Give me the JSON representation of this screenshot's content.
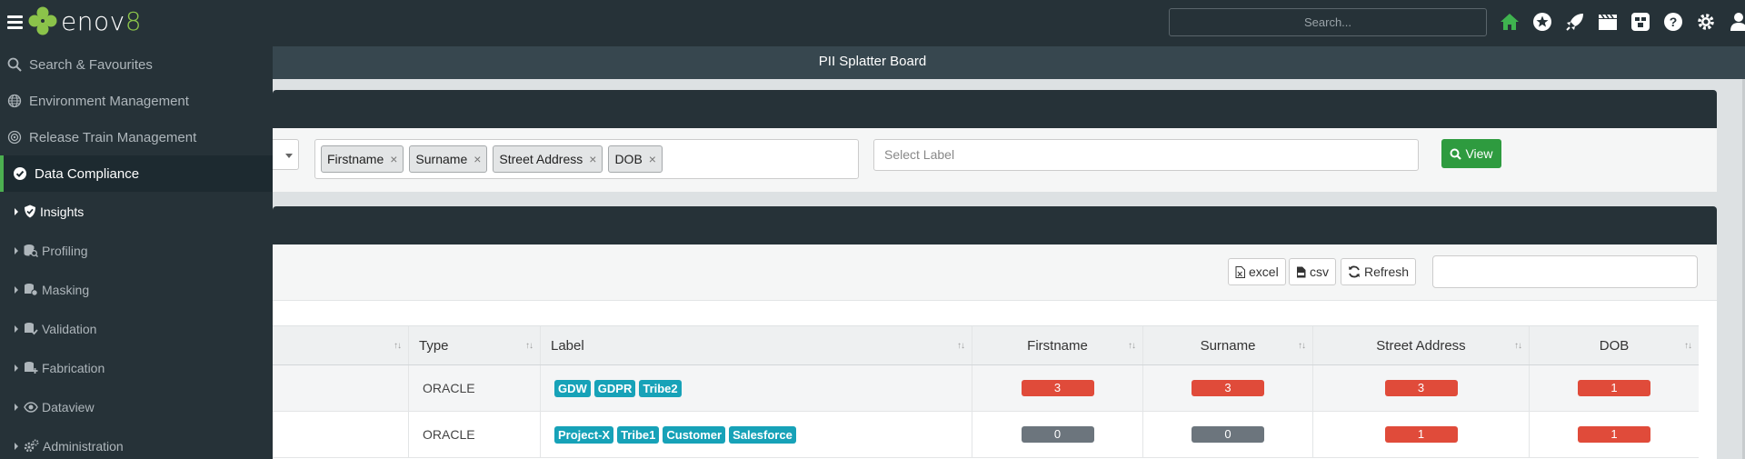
{
  "app": {
    "logo_text": "enov8",
    "search_placeholder": "Search...",
    "page_title": "PII Splatter Board"
  },
  "top_icons": [
    "home-icon",
    "star-icon",
    "rocket-icon",
    "clapper-icon",
    "slack-icon",
    "help-icon",
    "gear-icon",
    "user-icon"
  ],
  "colors": {
    "brand_green": "#8bc34a",
    "accent_green": "#2e9b3f",
    "dark": "#263238",
    "red": "#e04b3a",
    "teal": "#17a2b8",
    "grey": "#6c757d"
  },
  "sidebar": {
    "items": [
      {
        "label": "Search & Favourites",
        "icon": "search-icon"
      },
      {
        "label": "Environment Management",
        "icon": "globe-icon"
      },
      {
        "label": "Release Train Management",
        "icon": "target-icon"
      },
      {
        "label": "Data Compliance",
        "icon": "check-circle-icon"
      }
    ],
    "sub_items": [
      {
        "label": "Insights",
        "icon": "shield-check-icon"
      },
      {
        "label": "Profiling",
        "icon": "database-search-icon"
      },
      {
        "label": "Masking",
        "icon": "database-mask-icon"
      },
      {
        "label": "Validation",
        "icon": "database-check-icon"
      },
      {
        "label": "Fabrication",
        "icon": "database-plus-icon"
      },
      {
        "label": "Dataview",
        "icon": "eye-icon"
      },
      {
        "label": "Administration",
        "icon": "cogs-icon"
      }
    ]
  },
  "filters": {
    "tags": [
      "Firstname",
      "Surname",
      "Street Address",
      "DOB"
    ],
    "tag_remove": "×",
    "label_placeholder": "Select Label",
    "view_label": "View"
  },
  "toolbar": {
    "excel": "excel",
    "csv": "csv",
    "refresh": "Refresh"
  },
  "table": {
    "columns": [
      "",
      "Type",
      "Label",
      "Firstname",
      "Surname",
      "Street Address",
      "DOB"
    ],
    "rows": [
      {
        "type": "ORACLE",
        "labels": [
          "GDW",
          "GDPR",
          "Tribe2"
        ],
        "firstname": "3",
        "surname": "3",
        "street_address": "3",
        "dob": "1"
      },
      {
        "type": "ORACLE",
        "labels": [
          "Project-X",
          "Tribe1",
          "Customer",
          "Salesforce"
        ],
        "firstname": "0",
        "surname": "0",
        "street_address": "1",
        "dob": "1"
      }
    ]
  }
}
